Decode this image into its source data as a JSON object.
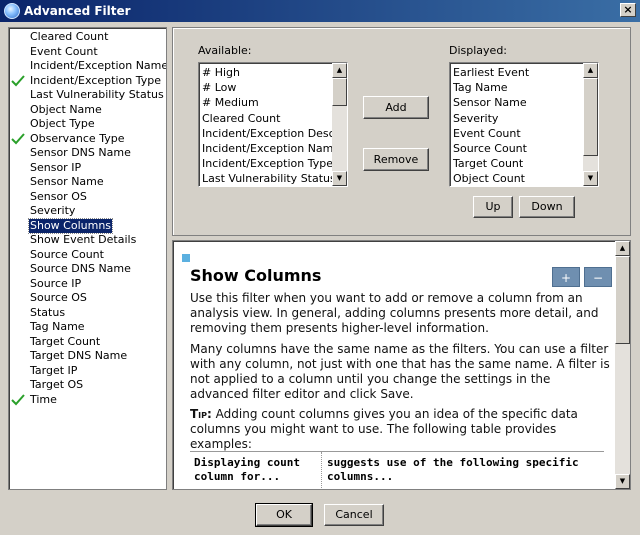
{
  "window": {
    "title": "Advanced Filter",
    "close_label": "×"
  },
  "filter_list": {
    "items": [
      {
        "label": "Cleared Count",
        "checked": false,
        "selected": false
      },
      {
        "label": "Event Count",
        "checked": false,
        "selected": false
      },
      {
        "label": "Incident/Exception Name",
        "checked": false,
        "selected": false
      },
      {
        "label": "Incident/Exception Type",
        "checked": true,
        "selected": false
      },
      {
        "label": "Last Vulnerability Status",
        "checked": false,
        "selected": false
      },
      {
        "label": "Object Name",
        "checked": false,
        "selected": false
      },
      {
        "label": "Object Type",
        "checked": false,
        "selected": false
      },
      {
        "label": "Observance Type",
        "checked": true,
        "selected": false
      },
      {
        "label": "Sensor DNS Name",
        "checked": false,
        "selected": false
      },
      {
        "label": "Sensor IP",
        "checked": false,
        "selected": false
      },
      {
        "label": "Sensor Name",
        "checked": false,
        "selected": false
      },
      {
        "label": "Sensor OS",
        "checked": false,
        "selected": false
      },
      {
        "label": "Severity",
        "checked": false,
        "selected": false
      },
      {
        "label": "Show Columns",
        "checked": false,
        "selected": true
      },
      {
        "label": "Show Event Details",
        "checked": false,
        "selected": false
      },
      {
        "label": "Source Count",
        "checked": false,
        "selected": false
      },
      {
        "label": "Source DNS Name",
        "checked": false,
        "selected": false
      },
      {
        "label": "Source IP",
        "checked": false,
        "selected": false
      },
      {
        "label": "Source OS",
        "checked": false,
        "selected": false
      },
      {
        "label": "Status",
        "checked": false,
        "selected": false
      },
      {
        "label": "Tag Name",
        "checked": false,
        "selected": false
      },
      {
        "label": "Target Count",
        "checked": false,
        "selected": false
      },
      {
        "label": "Target DNS Name",
        "checked": false,
        "selected": false
      },
      {
        "label": "Target IP",
        "checked": false,
        "selected": false
      },
      {
        "label": "Target OS",
        "checked": false,
        "selected": false
      },
      {
        "label": "Time",
        "checked": true,
        "selected": false
      }
    ]
  },
  "columns": {
    "available_label": "Available:",
    "displayed_label": "Displayed:",
    "available": [
      "# High",
      "# Low",
      "# Medium",
      "Cleared Count",
      "Incident/Exception Description",
      "Incident/Exception Name",
      "Incident/Exception Type",
      "Last Vulnerability Status"
    ],
    "displayed": [
      "Earliest Event",
      "Tag Name",
      "Sensor Name",
      "Severity",
      "Event Count",
      "Source Count",
      "Target Count",
      "Object Count"
    ],
    "add_label": "Add",
    "remove_label": "Remove",
    "up_label": "Up",
    "down_label": "Down"
  },
  "help": {
    "title": "Show Columns",
    "prev_label": "+",
    "next_label": "−",
    "para1": "Use this filter when you want to add or remove a column from an analysis view. In general, adding columns presents more detail, and removing them presents higher-level information.",
    "para2": "Many columns have the same name as the filters. You can use a filter with any column, not just with one that has the same name. A filter is not applied to a column until you change the settings in the advanced filter editor and click Save.",
    "tip_label": "Tip:",
    "tip_text": "Adding count columns gives you an idea of the specific data columns you might want to use. The following table provides examples:",
    "table_headers": [
      "Displaying count column for...",
      "suggests use of the following specific columns..."
    ]
  },
  "footer": {
    "ok_label": "OK",
    "cancel_label": "Cancel"
  },
  "colors": {
    "title_bar": "#0a246a",
    "selection": "#0a246a",
    "check": "#2aa02a",
    "nav_button": "#6f8fb0"
  }
}
